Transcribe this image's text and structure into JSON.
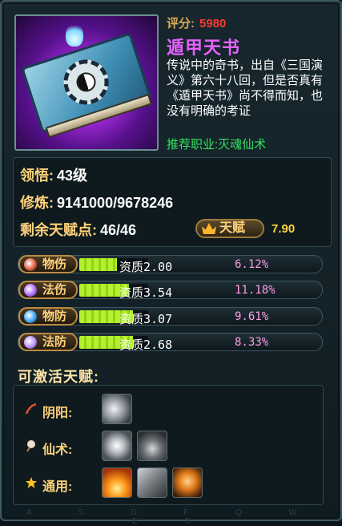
{
  "item": {
    "score_label": "评分:",
    "score_value": "5980",
    "name": "遁甲天书",
    "description": "传说中的奇书，出自《三国演义》第六十八回，但是否真有《遁甲天书》尚不得而知，也没有明确的考证",
    "recommend": "推荐职业:灭魂仙术",
    "icon": "book-icon"
  },
  "stats": {
    "comprehension_label": "领悟:",
    "comprehension_value": "43级",
    "cultivation_label": "修炼:",
    "cultivation_value": "9141000/9678246",
    "talent_points_label": "剩余天赋点:",
    "talent_points_value": "46/46",
    "talent_button": "天赋",
    "talent_value": "7.90"
  },
  "attributes": [
    {
      "label": "物伤",
      "quality": "资质2.00",
      "percent": "6.12%",
      "fill": 0.55,
      "icon_color": "#e05a3a"
    },
    {
      "label": "法伤",
      "quality": "资质3.54",
      "percent": "11.18%",
      "fill": 0.72,
      "icon_color": "#b16cff"
    },
    {
      "label": "物防",
      "quality": "资质3.07",
      "percent": "9.61%",
      "fill": 0.78,
      "icon_color": "#3aa4ff"
    },
    {
      "label": "法防",
      "quality": "资质2.68",
      "percent": "8.33%",
      "fill": 0.78,
      "icon_color": "#b890ff"
    }
  ],
  "activatable": {
    "title": "可激活天赋:",
    "rows": [
      {
        "label": "阴阳:",
        "icon": "yinyang-icon",
        "skills": [
          "swirl-skill-icon"
        ]
      },
      {
        "label": "仙术:",
        "icon": "immortal-art-icon",
        "skills": [
          "burst-skill-icon",
          "smoke-skill-icon"
        ]
      },
      {
        "label": "通用:",
        "icon": "star-icon",
        "skills": [
          "fire-skill-icon",
          "wolf-skill-icon",
          "spirit-skill-icon"
        ]
      }
    ]
  },
  "hotkeys": "A S D F Q W E R",
  "colors": {
    "score": "#ff3b2f",
    "item_name": "#e562ff",
    "recommend": "#34e060",
    "label": "#ffd27a",
    "percent": "#ff9de6",
    "bar": "#b6f02c"
  }
}
